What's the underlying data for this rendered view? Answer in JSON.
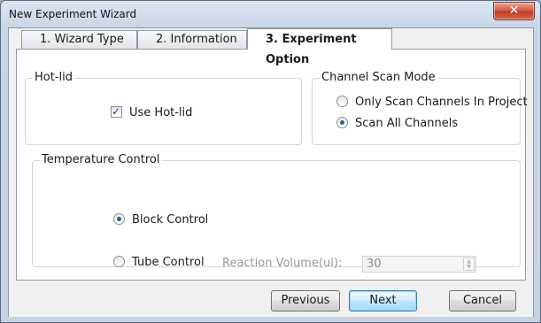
{
  "window": {
    "title": "New Experiment Wizard",
    "close_glyph": "✕"
  },
  "tabs": [
    {
      "label": "1. Wizard Type",
      "active": false
    },
    {
      "label": "2. Information",
      "active": false
    },
    {
      "label": "3. Experiment Option",
      "active": true
    }
  ],
  "hotlid": {
    "group_label": "Hot-lid",
    "checkbox_label": "Use Hot-lid",
    "checked": true,
    "check_glyph": "✓"
  },
  "channel_scan": {
    "group_label": "Channel Scan Mode",
    "options": [
      {
        "label": "Only Scan Channels In Project",
        "selected": false
      },
      {
        "label": "Scan All Channels",
        "selected": true
      }
    ]
  },
  "temperature": {
    "group_label": "Temperature Control",
    "options": [
      {
        "label": "Block Control",
        "selected": true
      },
      {
        "label": "Tube Control",
        "selected": false
      }
    ],
    "volume_label": "Reaction Volume(ul):",
    "volume_value": "30",
    "spin_up": "▲",
    "spin_down": "▼"
  },
  "buttons": {
    "previous": "Previous",
    "next": "Next",
    "cancel": "Cancel"
  },
  "colors": {
    "accent": "#2a5ba0",
    "close_button": "#c0391f",
    "default_button_border": "#3c7fb1"
  }
}
